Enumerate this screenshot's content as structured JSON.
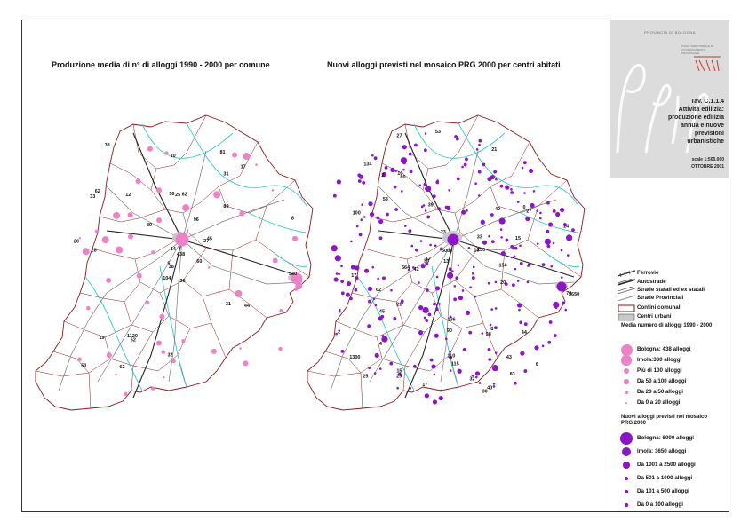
{
  "titles": {
    "left": "Produzione media di n° di alloggi 1990 - 2000 per comune",
    "right": "Nuovi alloggi previsti nel mosaico PRG 2000 per centri abitati"
  },
  "header": {
    "province": "PROVINCIA DI BOLOGNA",
    "office": "PIANO TERRITORIALE DI COORDINAMENTO PROVINCIALE",
    "tav": "Tav. C.1.1.4",
    "subject_lines": [
      "Attività edilizia:",
      "produzione edilizia",
      "annua e nuove",
      "previsioni",
      "urbanistiche"
    ],
    "scale": "scale 1:500.000",
    "date": "OTTOBRE 2001"
  },
  "legend": {
    "lines": [
      {
        "label": "Ferrovie",
        "style": "rail"
      },
      {
        "label": "Autostrade",
        "style": "motorway"
      },
      {
        "label": "Strade statali ed ex statali",
        "style": "state"
      },
      {
        "label": "Strade Provinciali",
        "style": "provincial"
      }
    ],
    "areas": [
      {
        "label": "Confini comunali",
        "style": "boundary"
      },
      {
        "label": "Centri urbani",
        "style": "urban"
      }
    ],
    "avg_title": "Media numero di alloggi 1990 - 2000",
    "avg_items": [
      {
        "label": "Bologna: 438 alloggi",
        "value": 438
      },
      {
        "label": "Imola:330 alloggi",
        "value": 330
      },
      {
        "label": "Più di 100 alloggi",
        "value": 100
      },
      {
        "label": "Da 50 a 100 alloggi",
        "value": 75
      },
      {
        "label": "Da 20 a 50 alloggi",
        "value": 35
      },
      {
        "label": "Da 0 a 20 alloggi",
        "value": 10
      }
    ],
    "new_title": "Nuovi alloggi previsti nel mosaico PRG 2000",
    "new_items": [
      {
        "label": "Bologna: 6000 alloggi",
        "value": 6000
      },
      {
        "label": "Imola: 3650 alloggi",
        "value": 3650
      },
      {
        "label": "Da 1001 a 2500 alloggi",
        "value": 1750
      },
      {
        "label": "Da 501 a 1000 alloggi",
        "value": 750
      },
      {
        "label": "Da 101 a 500 alloggi",
        "value": 300
      },
      {
        "label": "Da 0 a 100 alloggi",
        "value": 50
      }
    ]
  },
  "colors": {
    "boundary": "#8b1a1a",
    "rivers": "#33cccc",
    "roads": "#777777",
    "urban": "#c8c8c8",
    "pink": "#ee82c9",
    "purple": "#8a16c8"
  },
  "map_left_labels": [
    "438",
    "330",
    "36",
    "33",
    "38",
    "50",
    "27",
    "62",
    "81",
    "62",
    "31",
    "60",
    "38",
    "28",
    "104",
    "89",
    "56",
    "96",
    "19",
    "39",
    "62",
    "25",
    "45",
    "44",
    "62",
    "10",
    "20",
    "31",
    "8",
    "5",
    "32",
    "14",
    "12",
    "17",
    "1120"
  ],
  "map_right_labels": [
    "6000",
    "3650",
    "17",
    "30",
    "15",
    "43",
    "27",
    "134",
    "664",
    "53",
    "39",
    "115",
    "17",
    "90",
    "21",
    "13",
    "100",
    "29",
    "42",
    "98",
    "33",
    "27",
    "62",
    "2",
    "45",
    "20",
    "13",
    "40",
    "136",
    "4",
    "156",
    "1300",
    "40",
    "230",
    "15",
    "25",
    "80",
    "8",
    "70",
    "32",
    "2",
    "110",
    "14",
    "44",
    "21",
    "0",
    "50",
    "23",
    "10",
    "17",
    "6",
    "83",
    "53"
  ]
}
